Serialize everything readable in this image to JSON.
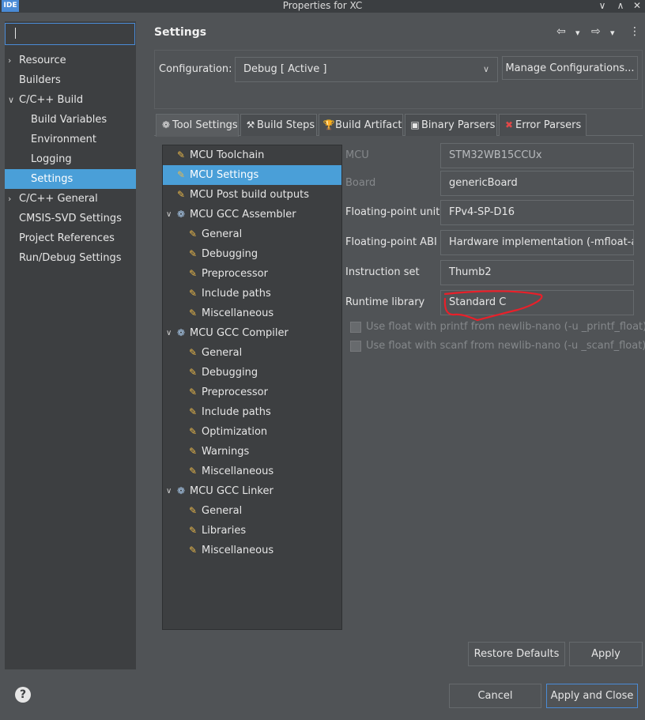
{
  "window": {
    "app_icon": "IDE",
    "title": "Properties for XC",
    "controls": {
      "minimize": "∨",
      "maximize": "∧",
      "close": "✕"
    }
  },
  "filter": {
    "value": ""
  },
  "nav": {
    "items": [
      {
        "label": "Resource",
        "level": 0,
        "chevron": "›"
      },
      {
        "label": "Builders",
        "level": 0,
        "chevron": ""
      },
      {
        "label": "C/C++ Build",
        "level": 0,
        "chevron": "∨"
      },
      {
        "label": "Build Variables",
        "level": 1,
        "chevron": ""
      },
      {
        "label": "Environment",
        "level": 1,
        "chevron": ""
      },
      {
        "label": "Logging",
        "level": 1,
        "chevron": ""
      },
      {
        "label": "Settings",
        "level": 1,
        "chevron": "",
        "selected": true
      },
      {
        "label": "C/C++ General",
        "level": 0,
        "chevron": "›"
      },
      {
        "label": "CMSIS-SVD Settings",
        "level": 0,
        "chevron": ""
      },
      {
        "label": "Project References",
        "level": 0,
        "chevron": ""
      },
      {
        "label": "Run/Debug Settings",
        "level": 0,
        "chevron": ""
      }
    ]
  },
  "header": {
    "title": "Settings",
    "icons": {
      "back": "⇦",
      "forward": "⇨",
      "dropdown": "▾",
      "menu": "⋮"
    }
  },
  "config": {
    "label": "Configuration:",
    "value": "Debug  [ Active ]",
    "arrow": "∨",
    "manage_label": "Manage Configurations..."
  },
  "tabs": [
    {
      "label": "Tool Settings",
      "icon": "❁",
      "icon_name": "gear-icon",
      "active": true
    },
    {
      "label": "Build Steps",
      "icon": "⚒",
      "icon_name": "hammer-icon"
    },
    {
      "label": "Build Artifact",
      "icon": "🏆",
      "icon_name": "trophy-icon"
    },
    {
      "label": "Binary Parsers",
      "icon": "▣",
      "icon_name": "binary-icon"
    },
    {
      "label": "Error Parsers",
      "icon": "✖",
      "icon_name": "error-icon"
    }
  ],
  "tree": {
    "items": [
      {
        "label": "MCU Toolchain",
        "level": 0,
        "chevron": "",
        "icon": "✎"
      },
      {
        "label": "MCU Settings",
        "level": 0,
        "chevron": "",
        "icon": "✎",
        "selected": true
      },
      {
        "label": "MCU Post build outputs",
        "level": 0,
        "chevron": "",
        "icon": "✎"
      },
      {
        "label": "MCU GCC Assembler",
        "level": 0,
        "chevron": "∨",
        "icon": "❁"
      },
      {
        "label": "General",
        "level": 1,
        "chevron": "",
        "icon": "✎"
      },
      {
        "label": "Debugging",
        "level": 1,
        "chevron": "",
        "icon": "✎"
      },
      {
        "label": "Preprocessor",
        "level": 1,
        "chevron": "",
        "icon": "✎"
      },
      {
        "label": "Include paths",
        "level": 1,
        "chevron": "",
        "icon": "✎"
      },
      {
        "label": "Miscellaneous",
        "level": 1,
        "chevron": "",
        "icon": "✎"
      },
      {
        "label": "MCU GCC Compiler",
        "level": 0,
        "chevron": "∨",
        "icon": "❁"
      },
      {
        "label": "General",
        "level": 1,
        "chevron": "",
        "icon": "✎"
      },
      {
        "label": "Debugging",
        "level": 1,
        "chevron": "",
        "icon": "✎"
      },
      {
        "label": "Preprocessor",
        "level": 1,
        "chevron": "",
        "icon": "✎"
      },
      {
        "label": "Include paths",
        "level": 1,
        "chevron": "",
        "icon": "✎"
      },
      {
        "label": "Optimization",
        "level": 1,
        "chevron": "",
        "icon": "✎"
      },
      {
        "label": "Warnings",
        "level": 1,
        "chevron": "",
        "icon": "✎"
      },
      {
        "label": "Miscellaneous",
        "level": 1,
        "chevron": "",
        "icon": "✎"
      },
      {
        "label": "MCU GCC Linker",
        "level": 0,
        "chevron": "∨",
        "icon": "❁"
      },
      {
        "label": "General",
        "level": 1,
        "chevron": "",
        "icon": "✎"
      },
      {
        "label": "Libraries",
        "level": 1,
        "chevron": "",
        "icon": "✎"
      },
      {
        "label": "Miscellaneous",
        "level": 1,
        "chevron": "",
        "icon": "✎"
      }
    ]
  },
  "fields": {
    "mcu": {
      "label": "MCU",
      "value": "STM32WB15CCUx"
    },
    "board": {
      "label": "Board",
      "value": "genericBoard"
    },
    "fpu": {
      "label": "Floating-point unit",
      "value": "FPv4-SP-D16"
    },
    "fpabi": {
      "label": "Floating-point ABI",
      "value": "Hardware implementation (-mfloat-abi=hard)"
    },
    "iset": {
      "label": "Instruction set",
      "value": "Thumb2"
    },
    "runtime": {
      "label": "Runtime library",
      "value": "Standard C"
    }
  },
  "checkboxes": {
    "printf": {
      "label": "Use float with printf from newlib-nano (-u _printf_float)",
      "checked": false
    },
    "scanf": {
      "label": "Use float with scanf from newlib-nano (-u _scanf_float)",
      "checked": false
    }
  },
  "buttons": {
    "restore": "Restore Defaults",
    "apply": "Apply",
    "cancel": "Cancel",
    "apply_close": "Apply and Close"
  },
  "help": {
    "label": "?"
  },
  "annotation_color": "#e8202a"
}
